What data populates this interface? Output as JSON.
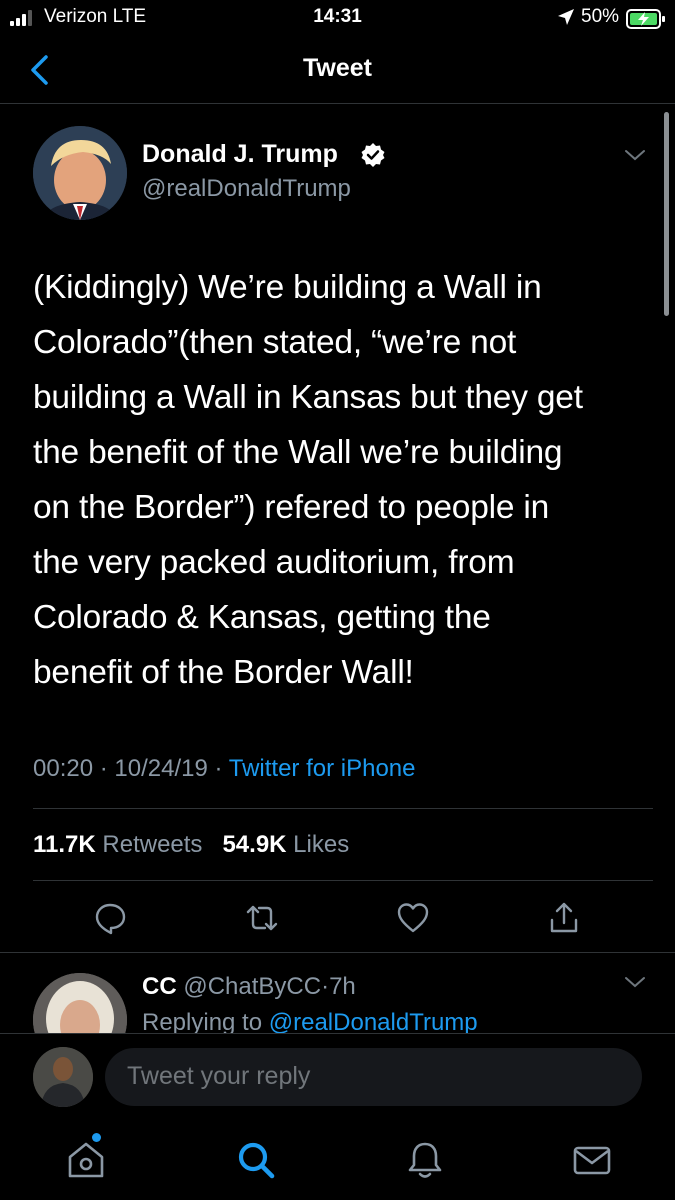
{
  "status_bar": {
    "carrier": "Verizon LTE",
    "time": "14:31",
    "battery": "50%",
    "icons": [
      "signal-icon",
      "location-arrow-icon",
      "battery-charging-icon"
    ]
  },
  "nav": {
    "title": "Tweet",
    "back_icon": "chevron-left-icon"
  },
  "tweet": {
    "author_name": "Donald J. Trump",
    "author_handle": "@realDonaldTrump",
    "verified": true,
    "text": "(Kiddingly) We’re building a Wall in\nColorado”(then stated, “we’re not\nbuilding a Wall in Kansas but they get\nthe benefit of the Wall we’re building\non the Border”) refered to people in\nthe very packed auditorium, from\nColorado & Kansas, getting the\nbenefit of the Border Wall!",
    "time": "00:20",
    "date": "10/24/19",
    "source": "Twitter for iPhone",
    "separator": "·",
    "retweets_count": "11.7K",
    "retweets_label": "Retweets",
    "likes_count": "54.9K",
    "likes_label": "Likes",
    "actions": [
      "reply-icon",
      "retweet-icon",
      "like-icon",
      "share-icon"
    ]
  },
  "reply": {
    "name": "CC",
    "handle": "@ChatByCC",
    "age": "7h",
    "replying_label": "Replying to",
    "replying_to": "@realDonaldTrump"
  },
  "compose": {
    "placeholder": "Tweet your reply"
  },
  "tab_bar": [
    "home-icon",
    "search-icon",
    "notifications-icon",
    "messages-icon"
  ],
  "colors": {
    "accent": "#1d9bf0",
    "secondary_text": "#8b98a5",
    "background": "#000000",
    "divider": "#2f3336"
  }
}
